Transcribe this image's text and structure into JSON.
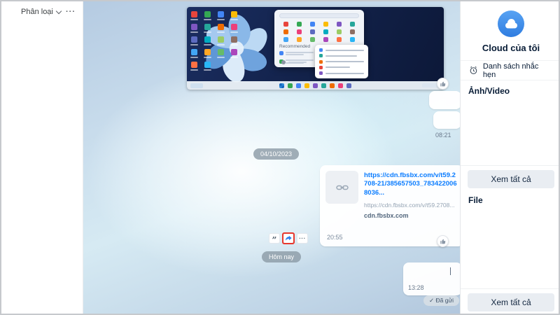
{
  "colors": {
    "accent_blue": "#0a7cff",
    "avatar_blue": "#2f7de0",
    "annotation_red": "#e8372d",
    "icon_palette": [
      "#e8453c",
      "#34a853",
      "#4285f4",
      "#fbbc05",
      "#7e57c2",
      "#26a69a",
      "#ef6c00",
      "#ec407a",
      "#5c6bc0",
      "#00acc1",
      "#9ccc65",
      "#8d6e63",
      "#42a5f5",
      "#ffa726",
      "#66bb6a",
      "#ab47bc",
      "#ff7043",
      "#29b6f6"
    ]
  },
  "left_panel": {
    "filter_label": "Phân loại",
    "more_label": "···"
  },
  "chat": {
    "screenshot_message": {
      "recommended_label": "Recommended"
    },
    "bubble_time_morning": "08:21",
    "date_divider": "04/10/2023",
    "link_message": {
      "link_text": "https://cdn.fbsbx.com/v/t59.2708-21/385657503_7834220068036...",
      "preview_text": "https://cdn.fbsbx.com/v/t59.2708...",
      "domain": "cdn.fbsbx.com",
      "time": "20:55"
    },
    "hover_actions": {
      "quote": "”",
      "more": "···"
    },
    "today_divider": "Hôm nay",
    "last_message_time": "13:28",
    "sent_check": "✓",
    "sent_status": "Đã gửi"
  },
  "right_panel": {
    "title": "Cloud của tôi",
    "reminder_label": "Danh sách nhắc hẹn",
    "photos_label": "Ảnh/Video",
    "photos_view_all": "Xem tất cả",
    "files_label": "File",
    "files_view_all": "Xem tất cả"
  }
}
